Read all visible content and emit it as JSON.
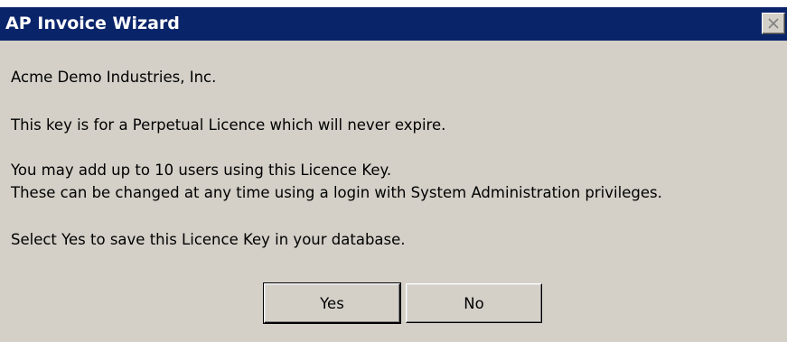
{
  "window": {
    "title": "AP Invoice Wizard",
    "close_icon": "close-icon"
  },
  "message": {
    "company": "Acme Demo Industries, Inc.",
    "licence_type": "This key is for a Perpetual Licence which will never expire.",
    "users_line1": "You may add up to 10 users using this Licence Key.",
    "users_line2": "These can be changed at any time using a login with System Administration privileges.",
    "prompt": "Select Yes to save this Licence Key in your database."
  },
  "buttons": {
    "yes_label": "Yes",
    "no_label": "No"
  },
  "colors": {
    "titlebar": "#0a246a",
    "dialog_face": "#d4d0c8"
  }
}
